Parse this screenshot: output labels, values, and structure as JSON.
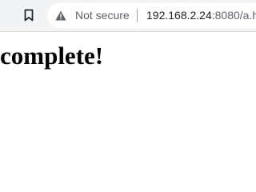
{
  "toolbar": {
    "bookmark_icon": "bookmark-icon",
    "omnibox": {
      "security_icon": "warning-triangle-icon",
      "security_label": "Not secure",
      "url_host": "192.168.2.24",
      "url_rest": ":8080/a.h"
    }
  },
  "page": {
    "heading": "complete!"
  }
}
